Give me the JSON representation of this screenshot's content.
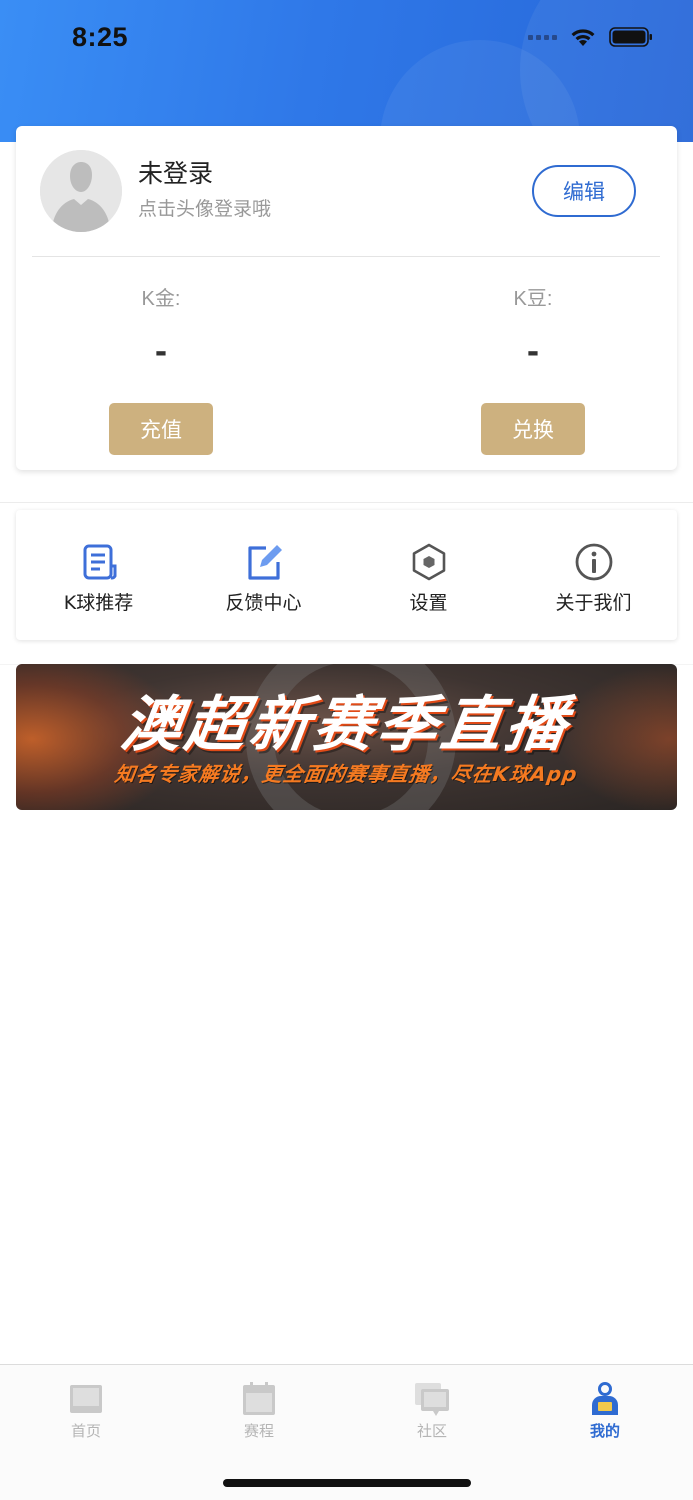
{
  "status_bar": {
    "time": "8:25"
  },
  "profile": {
    "name": "未登录",
    "hint": "点击头像登录哦",
    "edit_label": "编辑"
  },
  "wallet": {
    "gold": {
      "label": "K金:",
      "value": "-",
      "button": "充值"
    },
    "beans": {
      "label": "K豆:",
      "value": "-",
      "button": "兑换"
    }
  },
  "menu": {
    "items": [
      {
        "label": "K球推荐",
        "icon": "document-icon"
      },
      {
        "label": "反馈中心",
        "icon": "edit-icon"
      },
      {
        "label": "设置",
        "icon": "hexagon-settings-icon"
      },
      {
        "label": "关于我们",
        "icon": "info-icon"
      }
    ]
  },
  "banner": {
    "title": "澳超新赛季直播",
    "subtitle": "知名专家解说，更全面的赛事直播，尽在K球App"
  },
  "tabbar": {
    "active": "我的",
    "items": [
      {
        "label": "首页",
        "icon": "home-icon"
      },
      {
        "label": "赛程",
        "icon": "calendar-icon"
      },
      {
        "label": "社区",
        "icon": "community-icon"
      },
      {
        "label": "我的",
        "icon": "profile-icon"
      }
    ]
  },
  "colors": {
    "accent_blue": "#2f6bd1",
    "gold_button": "#cdb17f",
    "header_gradient_start": "#3a8ef5",
    "header_gradient_end": "#2767d8",
    "banner_text_orange": "#f57a21"
  }
}
